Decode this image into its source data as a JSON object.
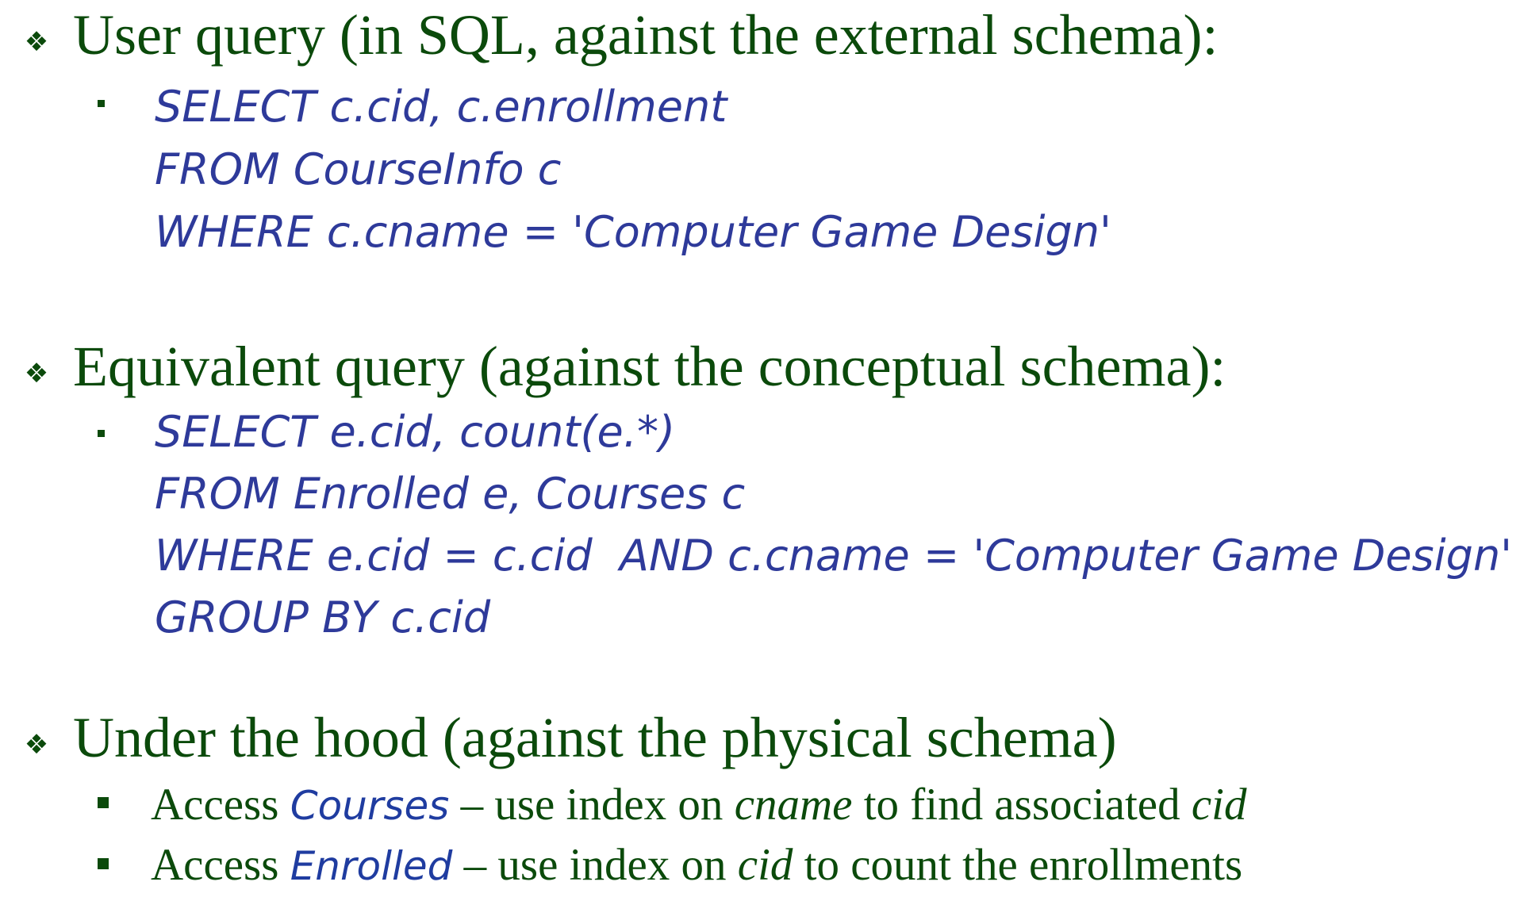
{
  "sections": [
    {
      "heading": "User query (in SQL, against the external schema):",
      "code_lines": [
        "SELECT c.cid, c.enrollment",
        "FROM CourseInfo c",
        "WHERE c.cname = 'Computer Game Design'"
      ]
    },
    {
      "heading": "Equivalent query (against the conceptual schema):",
      "code_lines": [
        "SELECT e.cid, count(e.*)",
        "FROM Enrolled e, Courses c",
        "WHERE e.cid = c.cid  AND c.cname = 'Computer Game Design'",
        "GROUP BY c.cid"
      ]
    },
    {
      "heading": "Under the hood (against the physical schema)",
      "items": [
        {
          "prefix": "Access ",
          "table": "Courses",
          "dash": " – ",
          "middle": "use index on ",
          "field": "cname",
          "suffix": " to find associated ",
          "tail_field": "cid"
        },
        {
          "prefix": "Access ",
          "table": "Enrolled",
          "dash": " – ",
          "middle": "use index on ",
          "field": "cid",
          "suffix": " to count the enrollments",
          "tail_field": ""
        }
      ]
    }
  ],
  "colors": {
    "heading_green": "#0b4a0b",
    "code_blue": "#2e3a9a",
    "table_blue": "#1f3ca0"
  },
  "icons": {
    "section_bullet": "four-diamond-icon",
    "code_bullet": "small-square-icon",
    "item_bullet": "square-icon"
  }
}
